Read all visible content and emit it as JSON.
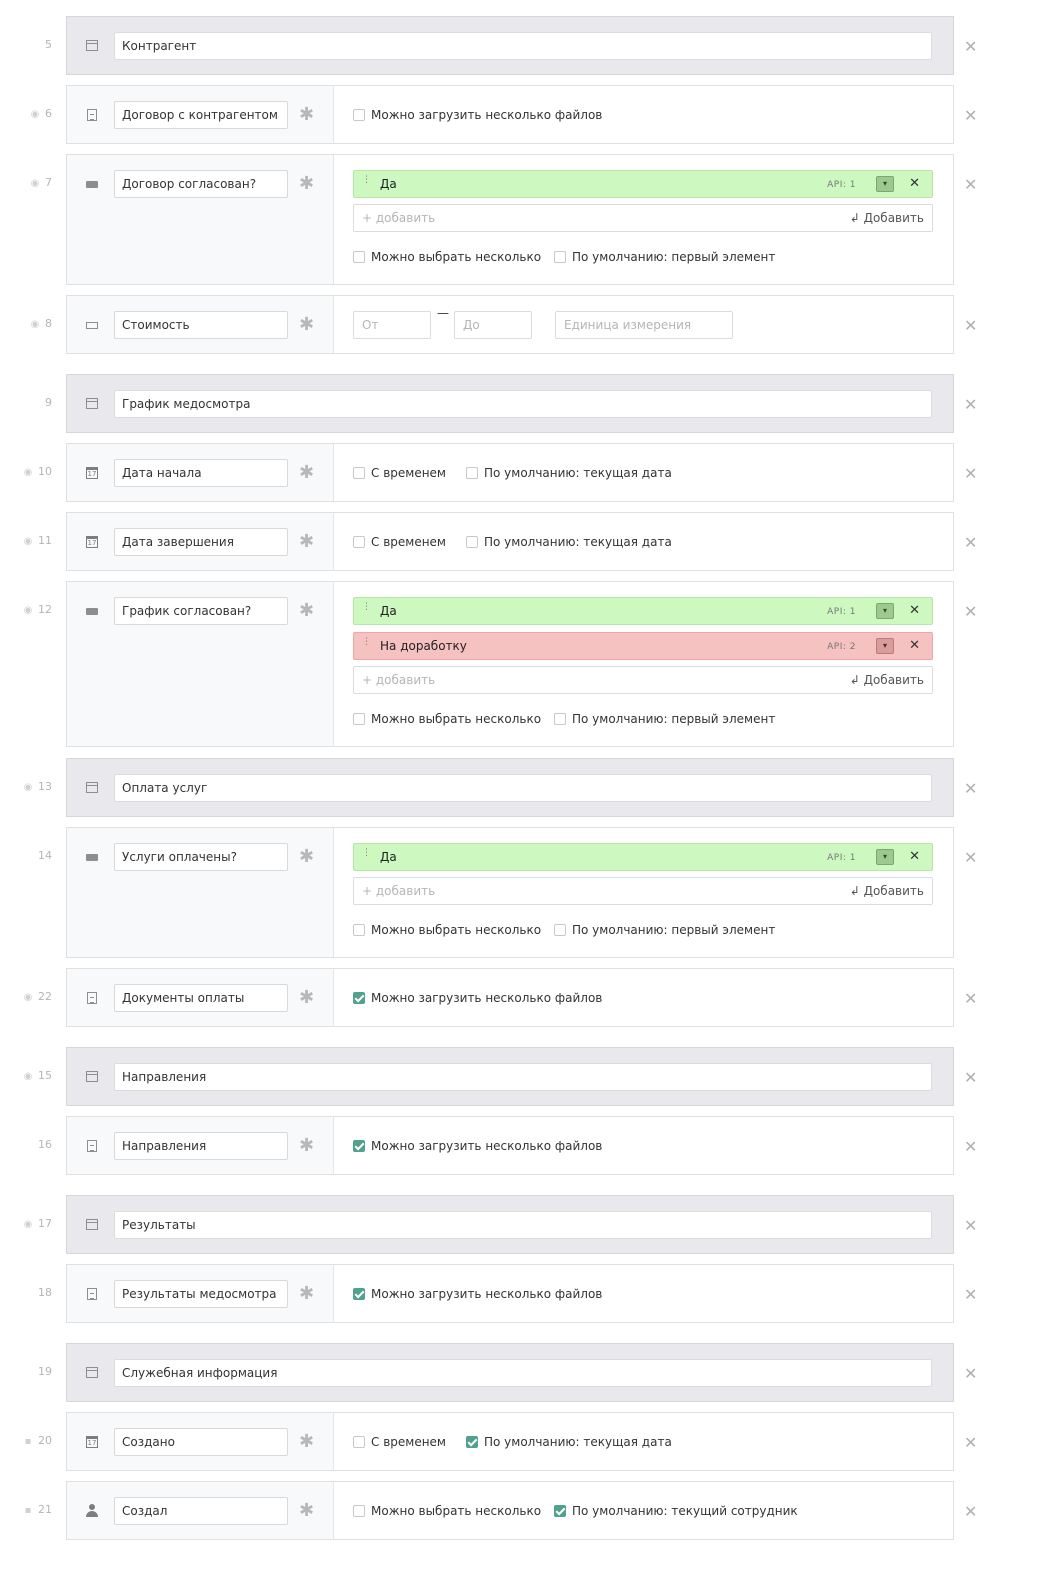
{
  "labels": {
    "required_mark": "✱",
    "delete_mark": "✕",
    "option_delete": "✕",
    "dropdown_mark": "▾",
    "drag_mark": "⋮",
    "add_placeholder": "+ добавить",
    "add_button": "↲ Добавить",
    "range_dash": "—"
  },
  "icons": {
    "eye": "eye-icon",
    "lock": "lock-icon",
    "section": "section-icon",
    "file": "file-icon",
    "select": "select-icon",
    "number": "number-icon",
    "date": "calendar-icon",
    "user": "user-icon"
  },
  "colors": {
    "option_green": "#cdf9c1",
    "option_red": "#f6c1c1",
    "checkbox_checked": "#52a08e",
    "section_bg": "#e9e9ed"
  },
  "rows": [
    {
      "num": "5",
      "prefix": "",
      "type": "section",
      "name": "Контрагент"
    },
    {
      "num": "6",
      "prefix": "eye",
      "type": "file",
      "name": "Договор с контрагентом",
      "checks": [
        {
          "label": "Можно загрузить несколько файлов",
          "checked": false
        }
      ]
    },
    {
      "num": "7",
      "prefix": "eye",
      "type": "select",
      "name": "Договор согласован?",
      "options": [
        {
          "label": "Да",
          "api": "API: 1",
          "color": "green"
        }
      ],
      "checks": [
        {
          "label": "Можно выбрать несколько",
          "checked": false
        },
        {
          "label": "По умолчанию: первый элемент",
          "checked": false
        }
      ]
    },
    {
      "num": "8",
      "prefix": "eye",
      "type": "number",
      "name": "Стоимость",
      "range": {
        "from": "От",
        "to": "До",
        "unit": "Единица измерения"
      }
    },
    {
      "num": "9",
      "prefix": "",
      "type": "section",
      "name": "График медосмотра"
    },
    {
      "num": "10",
      "prefix": "eye",
      "type": "date",
      "name": "Дата начала",
      "checks": [
        {
          "label": "С временем",
          "checked": false
        },
        {
          "label": "По умолчанию: текущая дата",
          "checked": false
        }
      ]
    },
    {
      "num": "11",
      "prefix": "eye",
      "type": "date",
      "name": "Дата завершения",
      "checks": [
        {
          "label": "С временем",
          "checked": false
        },
        {
          "label": "По умолчанию: текущая дата",
          "checked": false
        }
      ]
    },
    {
      "num": "12",
      "prefix": "eye",
      "type": "select",
      "name": "График согласован?",
      "options": [
        {
          "label": "Да",
          "api": "API: 1",
          "color": "green"
        },
        {
          "label": "На доработку",
          "api": "API: 2",
          "color": "red"
        }
      ],
      "checks": [
        {
          "label": "Можно выбрать несколько",
          "checked": false
        },
        {
          "label": "По умолчанию: первый элемент",
          "checked": false
        }
      ]
    },
    {
      "num": "13",
      "prefix": "eye",
      "type": "section",
      "name": "Оплата услуг"
    },
    {
      "num": "14",
      "prefix": "",
      "type": "select",
      "name": "Услуги оплачены?",
      "options": [
        {
          "label": "Да",
          "api": "API: 1",
          "color": "green"
        }
      ],
      "checks": [
        {
          "label": "Можно выбрать несколько",
          "checked": false
        },
        {
          "label": "По умолчанию: первый элемент",
          "checked": false
        }
      ]
    },
    {
      "num": "22",
      "prefix": "eye",
      "type": "file",
      "name": "Документы оплаты",
      "checks": [
        {
          "label": "Можно загрузить несколько файлов",
          "checked": true
        }
      ]
    },
    {
      "num": "15",
      "prefix": "eye",
      "type": "section",
      "name": "Направления"
    },
    {
      "num": "16",
      "prefix": "",
      "type": "file",
      "name": "Направления",
      "checks": [
        {
          "label": "Можно загрузить несколько файлов",
          "checked": true
        }
      ]
    },
    {
      "num": "17",
      "prefix": "eye",
      "type": "section",
      "name": "Результаты"
    },
    {
      "num": "18",
      "prefix": "",
      "type": "file",
      "name": "Результаты медосмотра",
      "checks": [
        {
          "label": "Можно загрузить несколько файлов",
          "checked": true
        }
      ]
    },
    {
      "num": "19",
      "prefix": "",
      "type": "section",
      "name": "Служебная информация"
    },
    {
      "num": "20",
      "prefix": "lock",
      "type": "date",
      "name": "Создано",
      "checks": [
        {
          "label": "С временем",
          "checked": false
        },
        {
          "label": "По умолчанию: текущая дата",
          "checked": true
        }
      ]
    },
    {
      "num": "21",
      "prefix": "lock",
      "type": "user",
      "name": "Создал",
      "checks": [
        {
          "label": "Можно выбрать несколько",
          "checked": false
        },
        {
          "label": "По умолчанию: текущий сотрудник",
          "checked": true
        }
      ]
    }
  ]
}
